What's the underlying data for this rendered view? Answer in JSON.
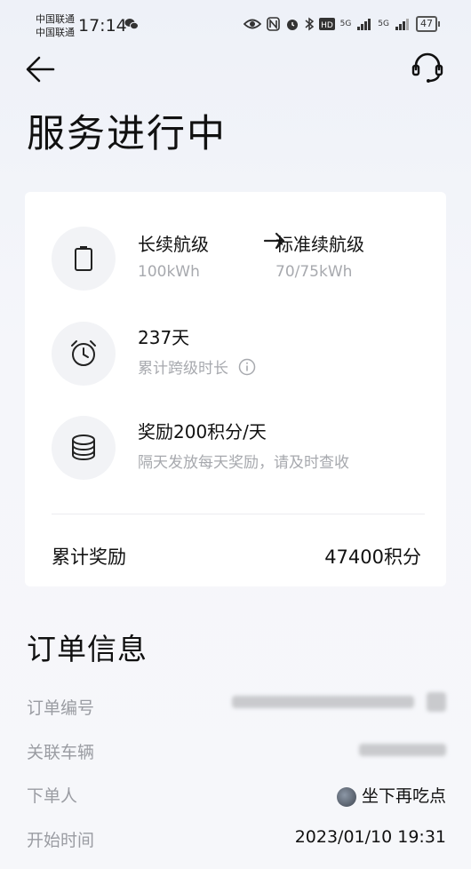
{
  "status_bar": {
    "carrier1": "中国联通",
    "carrier2": "中国联通",
    "time": "17:14",
    "network1": "5G",
    "network2": "5G",
    "battery": "47"
  },
  "header": {
    "title": "服务进行中"
  },
  "upgrade": {
    "from_label": "长续航级",
    "from_capacity": "100kWh",
    "to_label": "标准续航级",
    "to_capacity": "70/75kWh"
  },
  "duration": {
    "value": "237天",
    "label": "累计跨级时长"
  },
  "reward": {
    "title": "奖励200积分/天",
    "note": "隔天发放每天奖励，请及时查收"
  },
  "total": {
    "label": "累计奖励",
    "value": "47400积分"
  },
  "order": {
    "title": "订单信息",
    "rows": [
      {
        "label": "订单编号"
      },
      {
        "label": "关联车辆"
      },
      {
        "label": "下单人",
        "value": "坐下再吃点"
      },
      {
        "label": "开始时间",
        "value": "2023/01/10 19:31"
      }
    ]
  }
}
